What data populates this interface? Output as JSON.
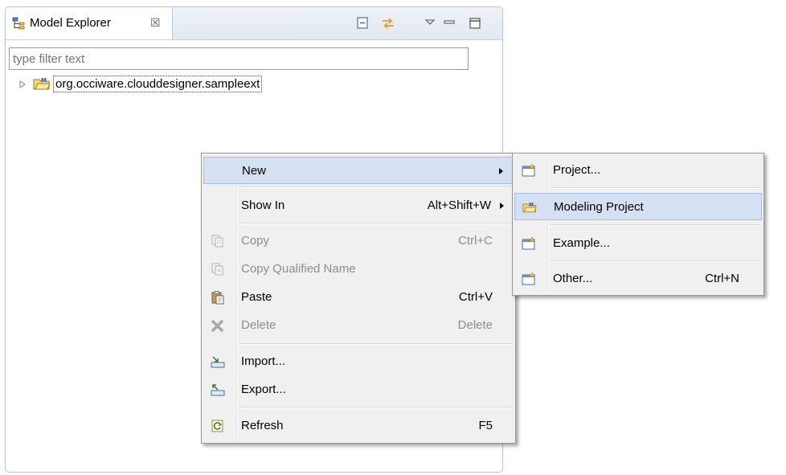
{
  "view": {
    "tab_title": "Model Explorer",
    "tab_close_glyph": "☒",
    "tab_icon": "model-explorer-icon",
    "filter_placeholder": "type filter text",
    "header_buttons": [
      "collapse-all-icon",
      "link-with-editor-icon",
      "view-menu-icon",
      "minimize-icon",
      "maximize-icon"
    ]
  },
  "tree": {
    "items": [
      {
        "label": "org.occiware.clouddesigner.sampleext",
        "icon": "modeling-project-icon",
        "expanded": false
      }
    ]
  },
  "context_menu": {
    "items": [
      {
        "label": "New",
        "shortcut": "",
        "submenu": true,
        "enabled": true,
        "highlighted": true,
        "icon": ""
      },
      {
        "label": "Show In",
        "shortcut": "Alt+Shift+W",
        "submenu": true,
        "enabled": true,
        "highlighted": false,
        "icon": ""
      },
      {
        "label": "Copy",
        "shortcut": "Ctrl+C",
        "submenu": false,
        "enabled": false,
        "highlighted": false,
        "icon": "copy-icon"
      },
      {
        "label": "Copy Qualified Name",
        "shortcut": "",
        "submenu": false,
        "enabled": false,
        "highlighted": false,
        "icon": "copy-qualified-name-icon"
      },
      {
        "label": "Paste",
        "shortcut": "Ctrl+V",
        "submenu": false,
        "enabled": true,
        "highlighted": false,
        "icon": "paste-icon"
      },
      {
        "label": "Delete",
        "shortcut": "Delete",
        "submenu": false,
        "enabled": false,
        "highlighted": false,
        "icon": "delete-icon"
      },
      {
        "label": "Import...",
        "shortcut": "",
        "submenu": false,
        "enabled": true,
        "highlighted": false,
        "icon": "import-icon"
      },
      {
        "label": "Export...",
        "shortcut": "",
        "submenu": false,
        "enabled": true,
        "highlighted": false,
        "icon": "export-icon"
      },
      {
        "label": "Refresh",
        "shortcut": "F5",
        "submenu": false,
        "enabled": true,
        "highlighted": false,
        "icon": "refresh-icon"
      }
    ]
  },
  "new_submenu": {
    "items": [
      {
        "label": "Project...",
        "shortcut": "",
        "highlighted": false,
        "icon": "new-project-icon"
      },
      {
        "label": "Modeling Project",
        "shortcut": "",
        "highlighted": true,
        "icon": "modeling-project-icon"
      },
      {
        "label": "Example...",
        "shortcut": "",
        "highlighted": false,
        "icon": "new-example-icon"
      },
      {
        "label": "Other...",
        "shortcut": "Ctrl+N",
        "highlighted": false,
        "icon": "new-other-icon"
      }
    ]
  },
  "colors": {
    "highlight_bg": "#d5e1f2",
    "highlight_border": "#a3bde3",
    "menu_bg": "#f0f0f0",
    "disabled_text": "#8d8d8d"
  }
}
